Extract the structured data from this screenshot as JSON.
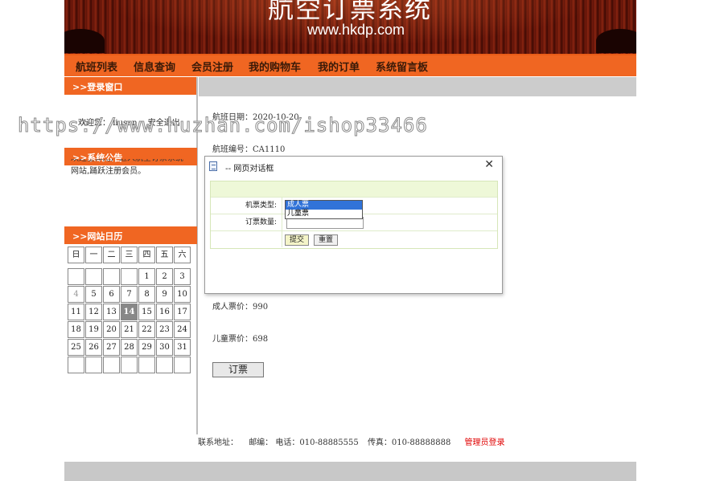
{
  "banner": {
    "title": "航空订票系统",
    "url": "www.hkdp.com"
  },
  "nav": [
    "航班列表",
    "信息查询",
    "会员注册",
    "我的购物车",
    "我的订单",
    "系统留言板"
  ],
  "sidebar": {
    "login_title": ">>登录窗口",
    "welcome_prefix": "欢迎您：",
    "username": "liusan",
    "logout": "安全退出",
    "notice_title": ">>系统公告",
    "notice_line1": "欢迎全体用户进入航空订票系统",
    "notice_line2": "网站,踊跃注册会员。",
    "calendar_title": ">>网站日历",
    "weekdays": [
      "日",
      "一",
      "二",
      "三",
      "四",
      "五",
      "六"
    ],
    "today": "14"
  },
  "main": {
    "flight_date": "航班日期：2020-10-20",
    "flight_no": "航班编号：CA1110",
    "adult_price": "成人票价：990",
    "child_price": "儿童票价：698",
    "order_button": "订票"
  },
  "dialog": {
    "title": "-- 网页对话框",
    "ticket_type_label": "机票类型:",
    "quantity_label": "订票数量:",
    "options": [
      "成人票",
      "儿童票"
    ],
    "selected_option": "成人票",
    "submit": "提交",
    "reset": "重置"
  },
  "footer": {
    "address": "联系地址：",
    "postcode": "邮编：",
    "phone": "电话：010-88885555",
    "fax": "传真：010-88888888",
    "admin": "管理员登录"
  },
  "watermark": "https://www.huzhan.com/ishop33466",
  "colors": {
    "nav_orange": "#f06622",
    "banner_red": "#7a1c0c",
    "dialog_green": "#eef8d8",
    "selection_blue": "#3173d8",
    "admin_red": "#e00000"
  }
}
